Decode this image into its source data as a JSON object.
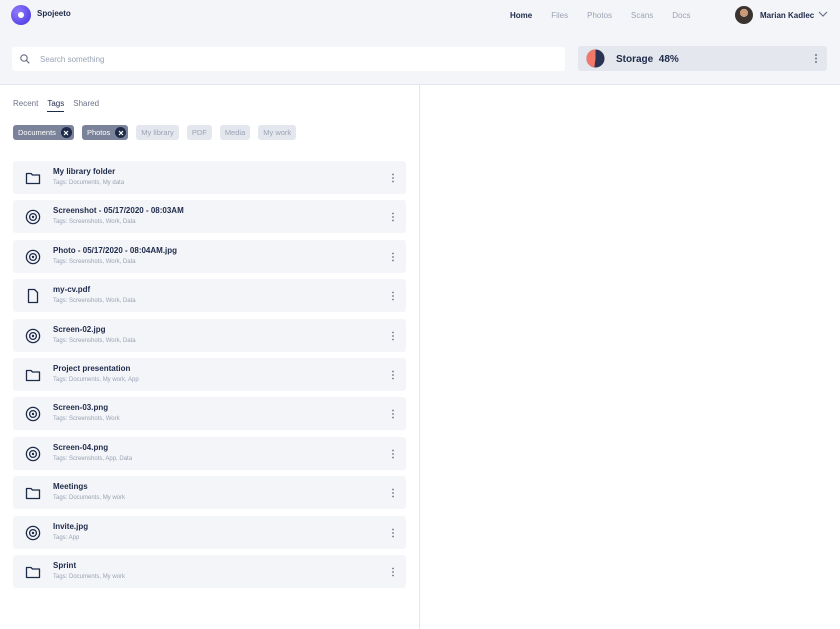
{
  "brand": {
    "name": "Spojeeto"
  },
  "nav": {
    "items": [
      "Home",
      "Files",
      "Photos",
      "Scans",
      "Docs"
    ],
    "active": "Home"
  },
  "user": {
    "name": "Marian Kadlec"
  },
  "search": {
    "placeholder": "Search something",
    "value": ""
  },
  "storage": {
    "label": "Storage",
    "percent_label": "48%",
    "used_fraction": 0.48
  },
  "tabs": {
    "items": [
      "Recent",
      "Tags",
      "Shared"
    ],
    "active": "Tags"
  },
  "tags": [
    {
      "label": "Documents",
      "selected": true
    },
    {
      "label": "Photos",
      "selected": true
    },
    {
      "label": "My library",
      "selected": false
    },
    {
      "label": "PDF",
      "selected": false
    },
    {
      "label": "Media",
      "selected": false
    },
    {
      "label": "My work",
      "selected": false
    }
  ],
  "files": [
    {
      "name": "My library folder",
      "tags": "Tags: Documents, My data",
      "icon": "folder-icon"
    },
    {
      "name": "Screenshot - 05/17/2020 - 08:03AM",
      "tags": "Tags: Screenshots, Work, Data",
      "icon": "image-icon"
    },
    {
      "name": "Photo - 05/17/2020 - 08:04AM.jpg",
      "tags": "Tags: Screenshots, Work, Data",
      "icon": "image-icon"
    },
    {
      "name": "my-cv.pdf",
      "tags": "Tags: Screenshots, Work, Data",
      "icon": "document-icon"
    },
    {
      "name": "Screen-02.jpg",
      "tags": "Tags: Screenshots, Work, Data",
      "icon": "image-icon"
    },
    {
      "name": "Project presentation",
      "tags": "Tags: Documents, My work, App",
      "icon": "folder-icon"
    },
    {
      "name": "Screen-03.png",
      "tags": "Tags: Screenshots, Work",
      "icon": "image-icon"
    },
    {
      "name": "Screen-04.png",
      "tags": "Tags: Screenshots, App, Data",
      "icon": "image-icon"
    },
    {
      "name": "Meetings",
      "tags": "Tags: Documents, My work",
      "icon": "folder-icon"
    },
    {
      "name": "Invite.jpg",
      "tags": "Tags: App",
      "icon": "image-icon"
    },
    {
      "name": "Sprint",
      "tags": "Tags: Documents, My work",
      "icon": "folder-icon"
    }
  ],
  "colors": {
    "accent": "#6a56f0",
    "ink": "#1e2a4a",
    "muted": "#9aa3b4",
    "chart_used": "#f2786a",
    "chart_free": "#2a3352"
  }
}
